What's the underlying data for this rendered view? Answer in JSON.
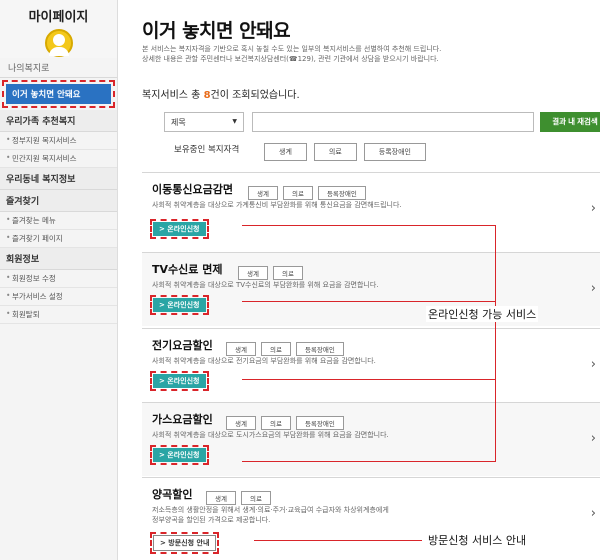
{
  "sidebar": {
    "title": "마이페이지",
    "my_welfare": "나의복지로",
    "active_item": "이거 놓치면 안돼요",
    "recommend_section": "우리가족 추천복지",
    "recommend_items": [
      "정부지원 복지서비스",
      "민간지원 복지서비스"
    ],
    "local_section": "우리동네 복지정보",
    "favorites_section": "즐겨찾기",
    "favorites_items": [
      "즐겨찾는 메뉴",
      "즐겨찾기 페이지"
    ],
    "member_section": "회원정보",
    "member_items": [
      "회원정보 수정",
      "부가서비스 설정",
      "회원탈퇴"
    ]
  },
  "main": {
    "title": "이거 놓치면 안돼요",
    "desc_line1": "본 서비스는 복지자격을 기반으로 혹시 놓칠 수도 있는 일부의 복지서비스를 선별하여 추천해 드립니다.",
    "desc_line2": "상세한 내용은 관할 주민센터나 보건복지상담센터(☎129), 관련 기관에서 상담을 받으시기 바랍니다.",
    "count_prefix": "복지서비스 총 ",
    "count_value": "8",
    "count_suffix": "건이 조회되었습니다."
  },
  "filter": {
    "select_value": "제목",
    "search_button": "결과 내 재검색",
    "holding_label": "보유중인 복지자격",
    "holding_tags": [
      "생계",
      "의료",
      "등록장애인"
    ]
  },
  "cards": [
    {
      "title": "이동통신요금감면",
      "tags": [
        "생계",
        "의료",
        "등록장애인"
      ],
      "desc": "사회적 취약계층을 대상으로 가계통신비 부담완화를 위해 통신요금을 감면해드립니다.",
      "button": "> 온라인신청"
    },
    {
      "title": "TV수신료 면제",
      "tags": [
        "생계",
        "의료"
      ],
      "desc": "사회적 취약계층을 대상으로 TV수신료의 부담완화를 위해 요금을 감면합니다.",
      "button": "> 온라인신청"
    },
    {
      "title": "전기요금할인",
      "tags": [
        "생계",
        "의료",
        "등록장애인"
      ],
      "desc": "사회적 취약계층을 대상으로 전기요금의 부담완화를 위해 요금을 감면합니다.",
      "button": "> 온라인신청"
    },
    {
      "title": "가스요금할인",
      "tags": [
        "생계",
        "의료",
        "등록장애인"
      ],
      "desc": "사회적 취약계층을 대상으로 도시가스요금의 부담완화를 위해 요금을 감면합니다.",
      "button": "> 온라인신청"
    },
    {
      "title": "양곡할인",
      "tags": [
        "생계",
        "의료"
      ],
      "desc_line1": "저소득층의 생활안정을 위해서 생계·의료·주거·교육급여 수급자와 차상위계층에게",
      "desc_line2": "정부양곡을 할인된 가격으로 제공합니다.",
      "button": "> 방문신청 안내"
    }
  ],
  "annotations": {
    "online": "온라인신청 가능 서비스",
    "visit": "방문신청 서비스 안내"
  },
  "icons": {
    "arrow": "›",
    "caret": "▼",
    "avatar": "user-avatar-icon"
  },
  "colors": {
    "accent_blue": "#2a72c2",
    "apply_teal": "#2aa5a5",
    "search_green": "#3e8f2f",
    "highlight_red": "#d9252a",
    "count_orange": "#e86c1a"
  }
}
